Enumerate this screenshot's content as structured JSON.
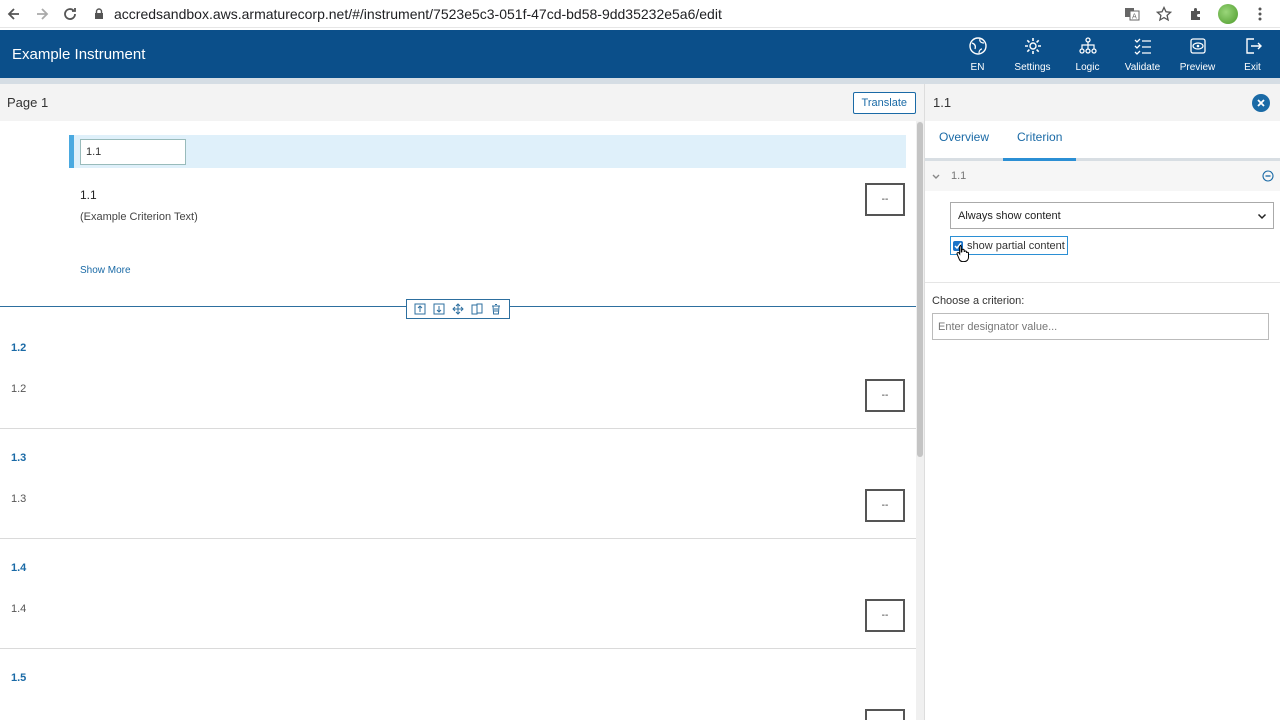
{
  "browser": {
    "url": "accredsandbox.aws.armaturecorp.net/#/instrument/7523e5c3-051f-47cd-bd58-9dd35232e5a6/edit"
  },
  "header": {
    "title": "Example Instrument",
    "buttons": [
      {
        "label": "EN",
        "icon": "globe-icon"
      },
      {
        "label": "Settings",
        "icon": "gear-icon"
      },
      {
        "label": "Logic",
        "icon": "logic-tree-icon"
      },
      {
        "label": "Validate",
        "icon": "checklist-icon"
      },
      {
        "label": "Preview",
        "icon": "preview-icon"
      },
      {
        "label": "Exit",
        "icon": "exit-icon"
      }
    ]
  },
  "page": {
    "title": "Page 1",
    "translate_label": "Translate"
  },
  "selected_criterion": {
    "designator_value": "1.1",
    "number": "1.1",
    "text": "(Example Criterion Text)",
    "show_more": "Show More",
    "score": "--"
  },
  "sections": [
    {
      "heading": "1.2",
      "sub": "1.2",
      "score": "--"
    },
    {
      "heading": "1.3",
      "sub": "1.3",
      "score": "--"
    },
    {
      "heading": "1.4",
      "sub": "1.4",
      "score": "--"
    },
    {
      "heading": "1.5",
      "sub": "",
      "score": "--"
    }
  ],
  "right_panel": {
    "title": "1.1",
    "tabs": [
      {
        "label": "Overview",
        "active": false
      },
      {
        "label": "Criterion",
        "active": true
      }
    ],
    "criterion_row_label": "1.1",
    "display_option": "Always show content",
    "show_partial_label": "show partial content",
    "show_partial_checked": true,
    "choose_label": "Choose a criterion:",
    "choose_placeholder": "Enter designator value..."
  },
  "colors": {
    "header_bg": "#0b4f8a",
    "accent": "#1a6aa6",
    "selection_bg": "#dff0fa"
  }
}
